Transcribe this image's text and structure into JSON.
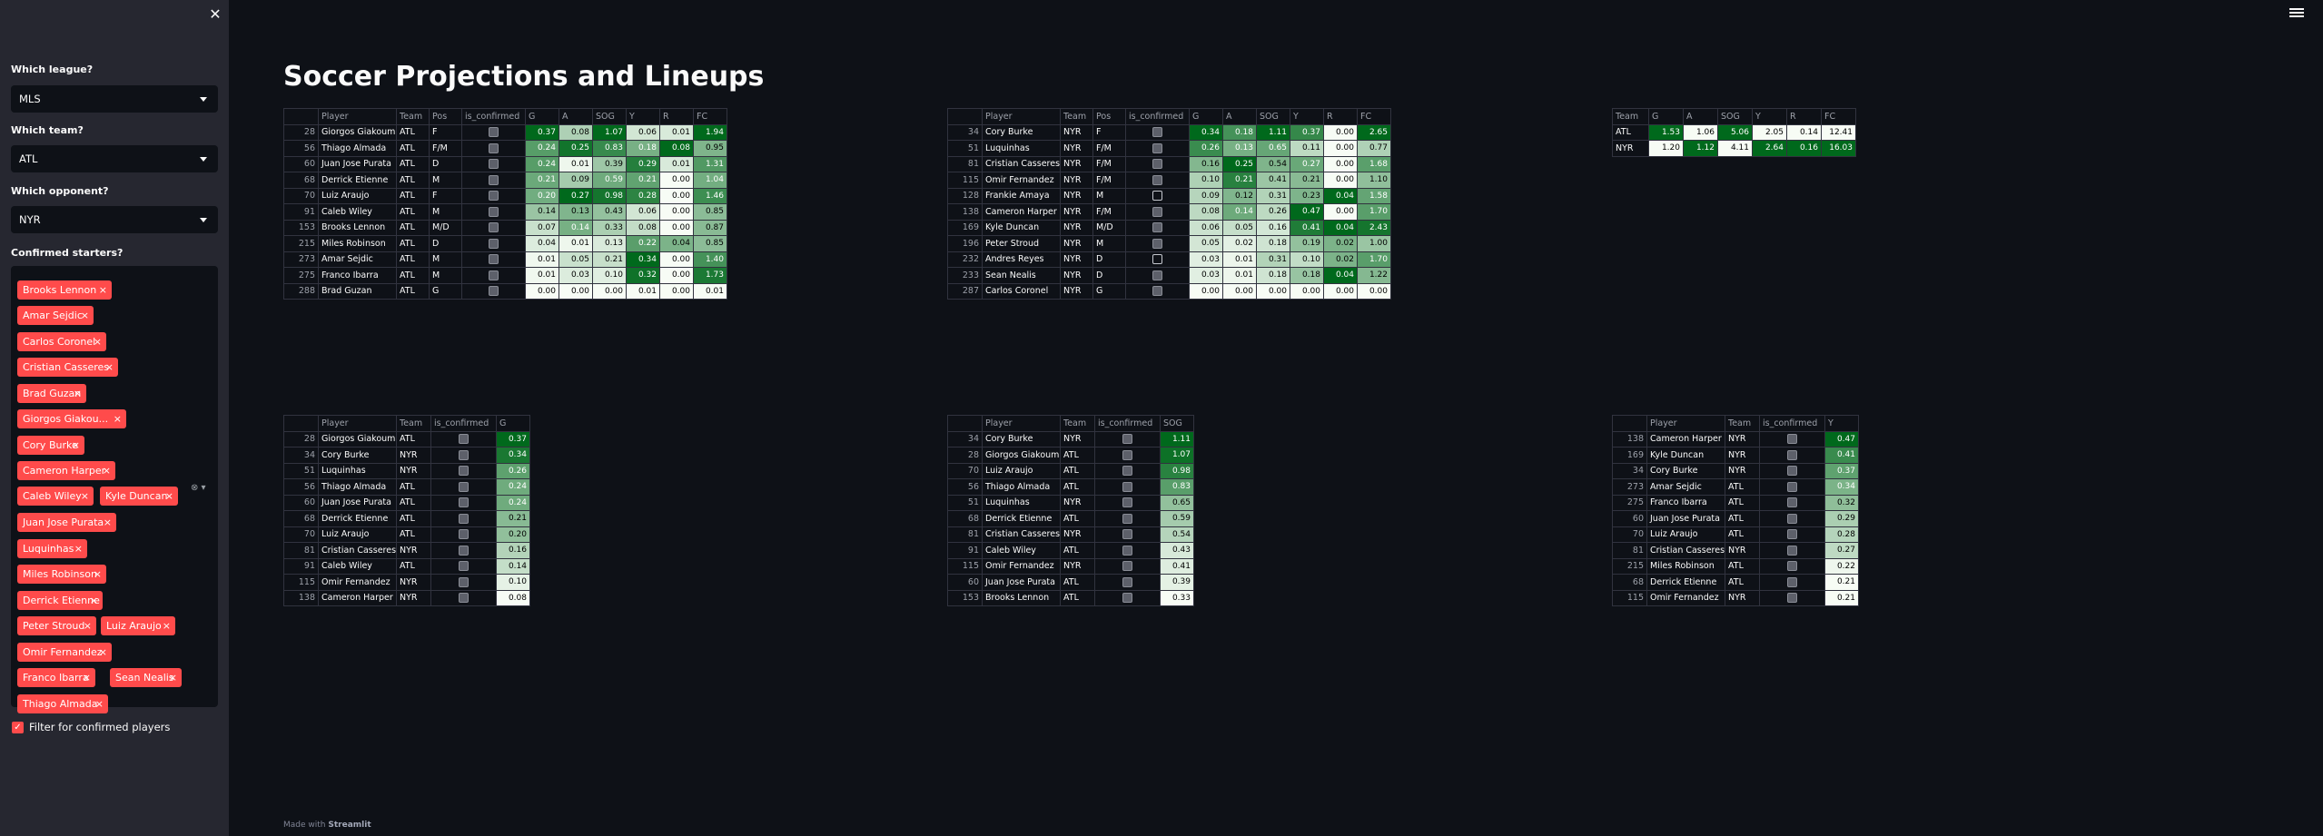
{
  "app": {
    "title": "Soccer Projections and Lineups",
    "footer_prefix": "Made with",
    "footer_brand": "Streamlit"
  },
  "sidebar": {
    "close_icon": "close-icon",
    "league": {
      "label": "Which league?",
      "value": "MLS"
    },
    "team": {
      "label": "Which team?",
      "value": "ATL"
    },
    "opponent": {
      "label": "Which opponent?",
      "value": "NYR"
    },
    "starters": {
      "label": "Confirmed starters?",
      "chips": [
        "Brooks Lennon",
        "Amar Sejdic",
        "Carlos Coronel",
        "Cristian Casseres",
        "Brad Guzan",
        "Giorgos Giakou...",
        "Cory Burke",
        "Cameron Harper",
        "Caleb Wiley",
        "Kyle Duncan",
        "Juan Jose Purata",
        "Luquinhas",
        "Miles Robinson",
        "Derrick Etienne",
        "Peter Stroud",
        "Luiz Araujo",
        "Omir Fernandez",
        "Franco Ibarra",
        "Sean Nealis",
        "Thiago Almada"
      ]
    },
    "filter": {
      "label": "Filter for confirmed players",
      "checked": true
    }
  },
  "colors": {
    "bg": "#0e1117",
    "sidebar": "#262730",
    "accent": "#ff4b4b",
    "green_max": "#00691c",
    "green_min": "#f7fcf5"
  },
  "team_atl": {
    "columns": [
      "",
      "Player",
      "Team",
      "Pos",
      "is_confirmed",
      "G",
      "A",
      "SOG",
      "Y",
      "R",
      "FC"
    ],
    "rows": [
      [
        "28",
        "Giorgos Giakoumal",
        "ATL",
        "F",
        1,
        "0.37",
        "0.08",
        "1.07",
        "0.06",
        "0.01",
        "1.94"
      ],
      [
        "56",
        "Thiago Almada",
        "ATL",
        "F/M",
        1,
        "0.24",
        "0.25",
        "0.83",
        "0.18",
        "0.08",
        "0.95"
      ],
      [
        "60",
        "Juan Jose Purata",
        "ATL",
        "D",
        1,
        "0.24",
        "0.01",
        "0.39",
        "0.29",
        "0.01",
        "1.31"
      ],
      [
        "68",
        "Derrick Etienne",
        "ATL",
        "M",
        1,
        "0.21",
        "0.09",
        "0.59",
        "0.21",
        "0.00",
        "1.04"
      ],
      [
        "70",
        "Luiz Araujo",
        "ATL",
        "F",
        1,
        "0.20",
        "0.27",
        "0.98",
        "0.28",
        "0.00",
        "1.46"
      ],
      [
        "91",
        "Caleb Wiley",
        "ATL",
        "M",
        1,
        "0.14",
        "0.13",
        "0.43",
        "0.06",
        "0.00",
        "0.85"
      ],
      [
        "153",
        "Brooks Lennon",
        "ATL",
        "M/D",
        1,
        "0.07",
        "0.14",
        "0.33",
        "0.08",
        "0.00",
        "0.87"
      ],
      [
        "215",
        "Miles Robinson",
        "ATL",
        "D",
        1,
        "0.04",
        "0.01",
        "0.13",
        "0.22",
        "0.04",
        "0.85"
      ],
      [
        "273",
        "Amar Sejdic",
        "ATL",
        "M",
        1,
        "0.01",
        "0.05",
        "0.21",
        "0.34",
        "0.00",
        "1.40"
      ],
      [
        "275",
        "Franco Ibarra",
        "ATL",
        "M",
        1,
        "0.01",
        "0.03",
        "0.10",
        "0.32",
        "0.00",
        "1.73"
      ],
      [
        "288",
        "Brad Guzan",
        "ATL",
        "G",
        1,
        "0.00",
        "0.00",
        "0.00",
        "0.01",
        "0.00",
        "0.01"
      ]
    ]
  },
  "team_nyr": {
    "columns": [
      "",
      "Player",
      "Team",
      "Pos",
      "is_confirmed",
      "G",
      "A",
      "SOG",
      "Y",
      "R",
      "FC"
    ],
    "rows": [
      [
        "34",
        "Cory Burke",
        "NYR",
        "F",
        1,
        "0.34",
        "0.18",
        "1.11",
        "0.37",
        "0.00",
        "2.65"
      ],
      [
        "51",
        "Luquinhas",
        "NYR",
        "F/M",
        1,
        "0.26",
        "0.13",
        "0.65",
        "0.11",
        "0.00",
        "0.77"
      ],
      [
        "81",
        "Cristian Casseres",
        "NYR",
        "F/M",
        1,
        "0.16",
        "0.25",
        "0.54",
        "0.27",
        "0.00",
        "1.68"
      ],
      [
        "115",
        "Omir Fernandez",
        "NYR",
        "F/M",
        1,
        "0.10",
        "0.21",
        "0.41",
        "0.21",
        "0.00",
        "1.10"
      ],
      [
        "128",
        "Frankie Amaya",
        "NYR",
        "M",
        0,
        "0.09",
        "0.12",
        "0.31",
        "0.23",
        "0.04",
        "1.58"
      ],
      [
        "138",
        "Cameron Harper",
        "NYR",
        "F/M",
        1,
        "0.08",
        "0.14",
        "0.26",
        "0.47",
        "0.00",
        "1.70"
      ],
      [
        "169",
        "Kyle Duncan",
        "NYR",
        "M/D",
        1,
        "0.06",
        "0.05",
        "0.16",
        "0.41",
        "0.04",
        "2.43"
      ],
      [
        "196",
        "Peter Stroud",
        "NYR",
        "M",
        1,
        "0.05",
        "0.02",
        "0.18",
        "0.19",
        "0.02",
        "1.00"
      ],
      [
        "232",
        "Andres Reyes",
        "NYR",
        "D",
        0,
        "0.03",
        "0.01",
        "0.31",
        "0.10",
        "0.02",
        "1.70"
      ],
      [
        "233",
        "Sean Nealis",
        "NYR",
        "D",
        1,
        "0.03",
        "0.01",
        "0.18",
        "0.18",
        "0.04",
        "1.22"
      ],
      [
        "287",
        "Carlos Coronel",
        "NYR",
        "G",
        1,
        "0.00",
        "0.00",
        "0.00",
        "0.00",
        "0.00",
        "0.00"
      ]
    ]
  },
  "team_totals": {
    "columns": [
      "Team",
      "G",
      "A",
      "SOG",
      "Y",
      "R",
      "FC"
    ],
    "rows": [
      [
        "ATL",
        "1.53",
        "1.06",
        "5.06",
        "2.05",
        "0.14",
        "12.41"
      ],
      [
        "NYR",
        "1.20",
        "1.12",
        "4.11",
        "2.64",
        "0.16",
        "16.03"
      ]
    ]
  },
  "top_g": {
    "columns": [
      "",
      "Player",
      "Team",
      "is_confirmed",
      "G"
    ],
    "rows": [
      [
        "28",
        "Giorgos Giakouma",
        "ATL",
        1,
        "0.37"
      ],
      [
        "34",
        "Cory Burke",
        "NYR",
        1,
        "0.34"
      ],
      [
        "51",
        "Luquinhas",
        "NYR",
        1,
        "0.26"
      ],
      [
        "56",
        "Thiago Almada",
        "ATL",
        1,
        "0.24"
      ],
      [
        "60",
        "Juan Jose Purata",
        "ATL",
        1,
        "0.24"
      ],
      [
        "68",
        "Derrick Etienne",
        "ATL",
        1,
        "0.21"
      ],
      [
        "70",
        "Luiz Araujo",
        "ATL",
        1,
        "0.20"
      ],
      [
        "81",
        "Cristian Casseres",
        "NYR",
        1,
        "0.16"
      ],
      [
        "91",
        "Caleb Wiley",
        "ATL",
        1,
        "0.14"
      ],
      [
        "115",
        "Omir Fernandez",
        "NYR",
        1,
        "0.10"
      ],
      [
        "138",
        "Cameron Harper",
        "NYR",
        1,
        "0.08"
      ]
    ]
  },
  "top_sog": {
    "columns": [
      "",
      "Player",
      "Team",
      "is_confirmed",
      "SOG"
    ],
    "rows": [
      [
        "34",
        "Cory Burke",
        "NYR",
        1,
        "1.11"
      ],
      [
        "28",
        "Giorgos Giakouma",
        "ATL",
        1,
        "1.07"
      ],
      [
        "70",
        "Luiz Araujo",
        "ATL",
        1,
        "0.98"
      ],
      [
        "56",
        "Thiago Almada",
        "ATL",
        1,
        "0.83"
      ],
      [
        "51",
        "Luquinhas",
        "NYR",
        1,
        "0.65"
      ],
      [
        "68",
        "Derrick Etienne",
        "ATL",
        1,
        "0.59"
      ],
      [
        "81",
        "Cristian Casseres",
        "NYR",
        1,
        "0.54"
      ],
      [
        "91",
        "Caleb Wiley",
        "ATL",
        1,
        "0.43"
      ],
      [
        "115",
        "Omir Fernandez",
        "NYR",
        1,
        "0.41"
      ],
      [
        "60",
        "Juan Jose Purata",
        "ATL",
        1,
        "0.39"
      ],
      [
        "153",
        "Brooks Lennon",
        "ATL",
        1,
        "0.33"
      ]
    ]
  },
  "top_y": {
    "columns": [
      "",
      "Player",
      "Team",
      "is_confirmed",
      "Y"
    ],
    "rows": [
      [
        "138",
        "Cameron Harper",
        "NYR",
        1,
        "0.47"
      ],
      [
        "169",
        "Kyle Duncan",
        "NYR",
        1,
        "0.41"
      ],
      [
        "34",
        "Cory Burke",
        "NYR",
        1,
        "0.37"
      ],
      [
        "273",
        "Amar Sejdic",
        "ATL",
        1,
        "0.34"
      ],
      [
        "275",
        "Franco Ibarra",
        "ATL",
        1,
        "0.32"
      ],
      [
        "60",
        "Juan Jose Purata",
        "ATL",
        1,
        "0.29"
      ],
      [
        "70",
        "Luiz Araujo",
        "ATL",
        1,
        "0.28"
      ],
      [
        "81",
        "Cristian Casseres",
        "NYR",
        1,
        "0.27"
      ],
      [
        "215",
        "Miles Robinson",
        "ATL",
        1,
        "0.22"
      ],
      [
        "68",
        "Derrick Etienne",
        "ATL",
        1,
        "0.21"
      ],
      [
        "115",
        "Omir Fernandez",
        "NYR",
        1,
        "0.21"
      ]
    ]
  }
}
